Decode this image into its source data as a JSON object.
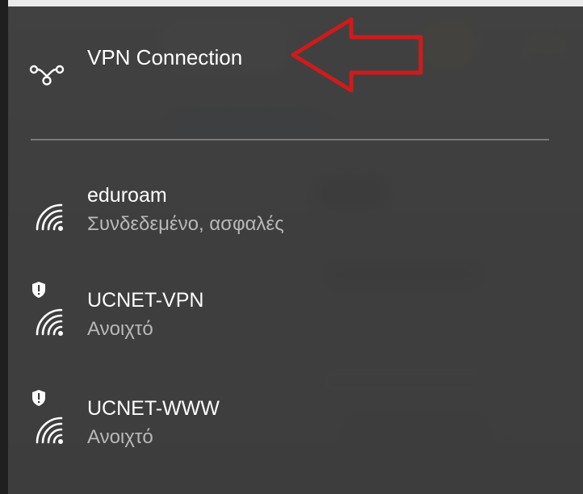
{
  "vpn": {
    "label": "VPN Connection",
    "icon": "vpn-icon"
  },
  "networks": [
    {
      "name": "eduroam",
      "status": "Συνδεδεμένο, ασφαλές",
      "icon": "wifi-icon",
      "secured": true
    },
    {
      "name": "UCNET-VPN",
      "status": "Ανοιχτό",
      "icon": "wifi-icon",
      "secured": false
    },
    {
      "name": "UCNET-WWW",
      "status": "Ανοιχτό",
      "icon": "wifi-icon",
      "secured": false
    }
  ],
  "colors": {
    "flyout_bg": "#3a3a3a",
    "text_primary": "#ffffff",
    "text_secondary": "#b8b8b8",
    "divider": "#7a7a7a",
    "annotation_arrow": "#d11a1a"
  }
}
